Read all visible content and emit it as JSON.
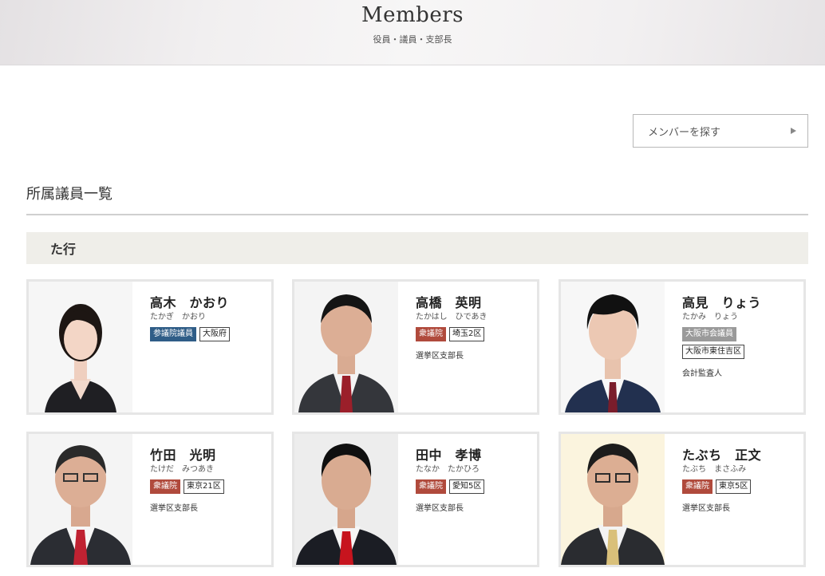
{
  "hero": {
    "title": "Members",
    "subtitle": "役員・議員・支部長"
  },
  "search": {
    "label": "メンバーを探す"
  },
  "section": {
    "title": "所属議員一覧",
    "group_label": "た行"
  },
  "colors": {
    "sangiin": "#2f5d87",
    "shugiin": "#b04a3c",
    "city": "#9a9a9a",
    "card_border": "#e6e6e6",
    "group_bg": "#efeee9"
  },
  "members": [
    {
      "name": "高木　かおり",
      "kana": "たかぎ　かおり",
      "house": "参議院議員",
      "house_type": "sangiin",
      "district": "大阪府",
      "role": ""
    },
    {
      "name": "高橋　英明",
      "kana": "たかはし　ひであき",
      "house": "衆議院",
      "house_type": "shugiin",
      "district": "埼玉2区",
      "role": "選挙区支部長"
    },
    {
      "name": "高見　りょう",
      "kana": "たかみ　りょう",
      "house": "大阪市会議員",
      "house_type": "city",
      "district": "大阪市東住吉区",
      "role": "会計監査人"
    },
    {
      "name": "竹田　光明",
      "kana": "たけだ　みつあき",
      "house": "衆議院",
      "house_type": "shugiin",
      "district": "東京21区",
      "role": "選挙区支部長"
    },
    {
      "name": "田中　孝博",
      "kana": "たなか　たかひろ",
      "house": "衆議院",
      "house_type": "shugiin",
      "district": "愛知5区",
      "role": "選挙区支部長"
    },
    {
      "name": "たぶち　正文",
      "kana": "たぶち　まさふみ",
      "house": "衆議院",
      "house_type": "shugiin",
      "district": "東京5区",
      "role": "選挙区支部長"
    }
  ]
}
